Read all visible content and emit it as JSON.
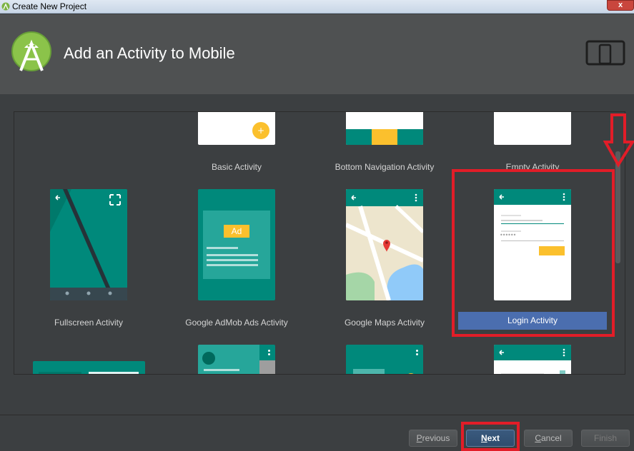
{
  "window": {
    "title": "Create New Project",
    "close_label": "x"
  },
  "header": {
    "title": "Add an Activity to Mobile",
    "logo_icon": "android-studio-logo-icon",
    "device_icon": "phone-tablet-icon"
  },
  "activities": [
    {
      "label": "Basic Activity",
      "preview": {
        "fab_symbol": "+"
      }
    },
    {
      "label": "Bottom Navigation Activity"
    },
    {
      "label": "Empty Activity"
    },
    {
      "label": "Fullscreen Activity"
    },
    {
      "label": "Google AdMob Ads Activity",
      "preview": {
        "ad_text": "Ad"
      }
    },
    {
      "label": "Google Maps Activity"
    },
    {
      "label": "Login Activity",
      "selected": true,
      "preview": {
        "password_mask": "••••••"
      }
    }
  ],
  "buttons": {
    "previous": {
      "label": "Previous",
      "mnemonic": "P",
      "rest": "revious"
    },
    "next": {
      "label": "Next",
      "mnemonic": "N",
      "rest": "ext"
    },
    "cancel": {
      "label": "Cancel",
      "mnemonic": "C",
      "rest": "ancel"
    },
    "finish": {
      "label": "Finish"
    }
  },
  "colors": {
    "accent": "#00897b",
    "header_bg": "#4f5152",
    "selection": "#4b6eaf",
    "highlight": "#e21d28",
    "fab": "#fbc02d"
  }
}
